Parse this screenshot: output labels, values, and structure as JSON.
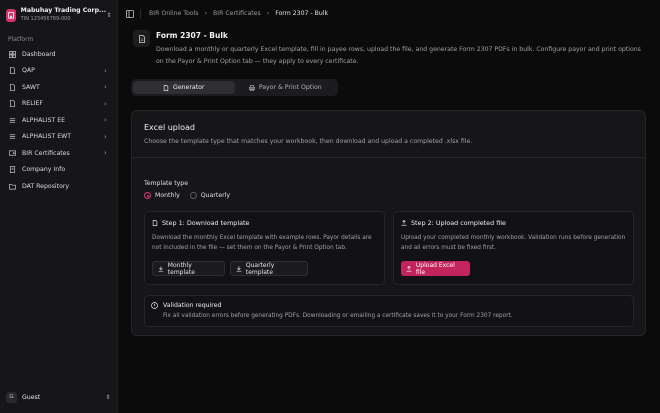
{
  "org": {
    "name": "Mabuhay Trading Corp...",
    "tin": "TIN 123456789-000",
    "logo_icon": "building-icon"
  },
  "sidebar": {
    "section_label": "Platform",
    "items": [
      {
        "label": "Dashboard",
        "icon": "dashboard-icon",
        "has_chevron": false
      },
      {
        "label": "QAP",
        "icon": "file-icon",
        "has_chevron": true
      },
      {
        "label": "SAWT",
        "icon": "file-icon",
        "has_chevron": true
      },
      {
        "label": "RELIEF",
        "icon": "file-icon",
        "has_chevron": true
      },
      {
        "label": "ALPHALIST EE",
        "icon": "list-icon",
        "has_chevron": true
      },
      {
        "label": "ALPHALIST EWT",
        "icon": "list-icon",
        "has_chevron": true
      },
      {
        "label": "BIR Certificates",
        "icon": "certificate-icon",
        "has_chevron": true
      },
      {
        "label": "Company Info",
        "icon": "building-icon",
        "has_chevron": false
      },
      {
        "label": "DAT Repository",
        "icon": "folder-icon",
        "has_chevron": false
      }
    ]
  },
  "user": {
    "initial": "G",
    "name": "Guest"
  },
  "breadcrumb": [
    "BIR Online Tools",
    "BIR Certificates",
    "Form 2307 - Bulk"
  ],
  "page": {
    "title": "Form 2307 - Bulk",
    "description": "Download a monthly or quarterly Excel template, fill in payee rows, upload the file, and generate Form 2307 PDFs in bulk. Configure payor and print options on the Payor & Print Option tab — they apply to every certificate."
  },
  "tabs": [
    {
      "label": "Generator",
      "active": true
    },
    {
      "label": "Payor & Print Option",
      "active": false
    }
  ],
  "card": {
    "title": "Excel upload",
    "description": "Choose the template type that matches your workbook, then download and upload a completed .xlsx file.",
    "template_type_label": "Template type",
    "template_options": [
      {
        "label": "Monthly",
        "selected": true
      },
      {
        "label": "Quarterly",
        "selected": false
      }
    ],
    "step1": {
      "title": "Step 1: Download template",
      "body": "Download the monthly Excel template with example rows. Payor details are not included in the file — set them on the Payor & Print Option tab.",
      "buttons": [
        "Monthly template",
        "Quarterly template"
      ]
    },
    "step2": {
      "title": "Step 2: Upload completed file",
      "body": "Upload your completed monthly workbook. Validation runs before generation and all errors must be fixed first.",
      "button": "Upload Excel file"
    },
    "alert": {
      "title": "Validation required",
      "body": "Fix all validation errors before generating PDFs. Downloading or emailing a certificate saves it to your Form 2307 report."
    }
  },
  "colors": {
    "accent": "#c2255c",
    "background": "#0b0b0c",
    "sidebar": "#161618"
  }
}
